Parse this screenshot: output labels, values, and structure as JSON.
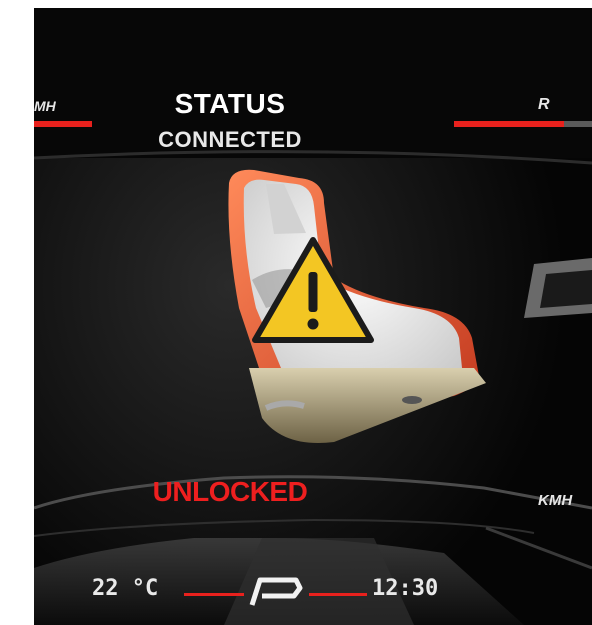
{
  "header": {
    "title": "STATUS",
    "subtitle": "CONNECTED",
    "left_label": "MH",
    "right_label": "R"
  },
  "seat": {
    "icon": "child-seat-warning-icon",
    "lock_state": "UNLOCKED"
  },
  "side": {
    "speed_unit": "KMH"
  },
  "footer": {
    "temperature": "22 °C",
    "gear": "P",
    "time": "12:30"
  },
  "colors": {
    "accent_red": "#e8211d",
    "warning_yellow": "#f3c623",
    "background": "#050505"
  }
}
